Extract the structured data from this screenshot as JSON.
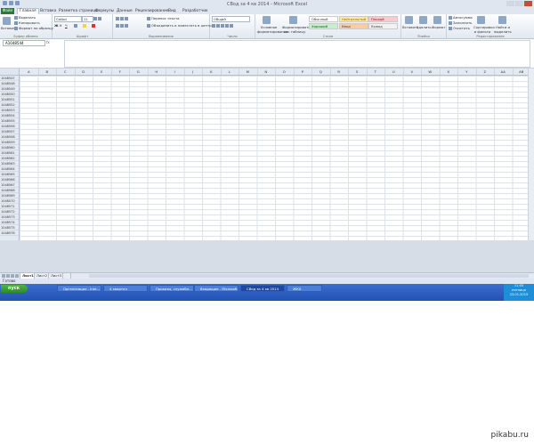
{
  "window": {
    "title": "СВод за 4 кв 2014 - Microsoft Excel"
  },
  "tabs": [
    "Файл",
    "Главная",
    "Вставка",
    "Разметка страницы",
    "Формулы",
    "Данные",
    "Рецензирование",
    "Вид",
    "Разработчик"
  ],
  "ribbon": {
    "clipboard": {
      "paste": "Вставить",
      "cut": "Вырезать",
      "copy": "Копировать",
      "format_painter": "Формат по образцу",
      "label": "Буфер обмена"
    },
    "font": {
      "name": "Calibri",
      "size": "11",
      "label": "Шрифт"
    },
    "alignment": {
      "wrap": "Перенос текста",
      "merge": "Объединить и поместить в центре",
      "label": "Выравнивание"
    },
    "number": {
      "format": "Общий",
      "label": "Число"
    },
    "styles": {
      "cond": "Условное форматирование",
      "table": "Форматировать как таблицу",
      "label": "Стили",
      "items": [
        "Обычный",
        "Нейтральный",
        "Плохой",
        "Хороший",
        "Ввод",
        "Вывод"
      ]
    },
    "cells": {
      "insert": "Вставить",
      "delete": "Удалить",
      "format": "Формат",
      "label": "Ячейки"
    },
    "editing": {
      "autosum": "Автосумма",
      "fill": "Заполнить",
      "clear": "Очистить",
      "sort": "Сортировка и фильтр",
      "find": "Найти и выделить",
      "label": "Редактирование"
    }
  },
  "formula": {
    "namebox": "A1048544",
    "fx": "fx"
  },
  "columns": [
    "A",
    "B",
    "C",
    "D",
    "E",
    "F",
    "G",
    "H",
    "I",
    "J",
    "K",
    "L",
    "M",
    "N",
    "O",
    "P",
    "Q",
    "R",
    "S",
    "T",
    "U",
    "V",
    "W",
    "X",
    "Y",
    "Z",
    "AA",
    "AB",
    "AC"
  ],
  "rows": [
    "1048547",
    "1048548",
    "1048549",
    "1048550",
    "1048551",
    "1048552",
    "1048553",
    "1048554",
    "1048555",
    "1048556",
    "1048557",
    "1048558",
    "1048559",
    "1048560",
    "1048561",
    "1048562",
    "1048563",
    "1048564",
    "1048565",
    "1048566",
    "1048567",
    "1048568",
    "1048569",
    "1048570",
    "1048571",
    "1048572",
    "1048573",
    "1048574",
    "1048575",
    "1048576"
  ],
  "sheets": [
    "Лист1",
    "Лист2",
    "Лист3"
  ],
  "status": "Готово",
  "taskbar": {
    "start": "пуск",
    "items": [
      "Организация - Inte...",
      "4 квартал",
      "Приказы, служебн...",
      "Входящие - Microsoft...",
      "СВод за 4 кв 2014",
      "ЖКХ"
    ],
    "clock": "11:05",
    "day": "пятница",
    "date": "23.01.2015"
  },
  "watermark": "pikabu.ru"
}
